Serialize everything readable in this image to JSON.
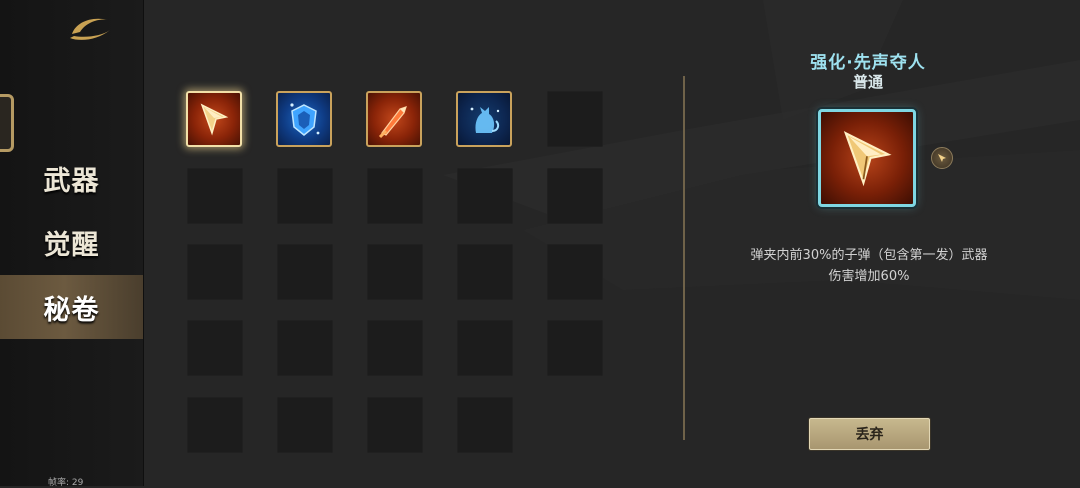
{
  "sidebar": {
    "nav": [
      {
        "label": "武器",
        "active": false
      },
      {
        "label": "觉醒",
        "active": false
      },
      {
        "label": "秘卷",
        "active": true
      }
    ],
    "fps_text": "帧率: 29"
  },
  "grid": {
    "columns": 5,
    "rows": 5,
    "items": [
      {
        "icon": "arrow-tip-icon",
        "rarity_color": "#c2471b",
        "selected": true
      },
      {
        "icon": "shield-sparkle-icon",
        "rarity_color": "#1c68c4",
        "selected": false
      },
      {
        "icon": "flame-blade-icon",
        "rarity_color": "#c2471b",
        "selected": false
      },
      {
        "icon": "spirit-cat-icon",
        "rarity_color": "#143c6e",
        "selected": false
      }
    ]
  },
  "detail": {
    "title": "强化·先声夺人",
    "rarity": "普通",
    "icon": "arrow-tip-icon",
    "description_line1": "弹夹内前30%的子弹（包含第一发）武器",
    "description_line2": "伤害增加60%",
    "discard_label": "丢弃"
  },
  "colors": {
    "title": "#9ee2f0",
    "selected_border": "#7fd7e3",
    "item_border": "#c9a25c",
    "button": "#b8a67e"
  }
}
